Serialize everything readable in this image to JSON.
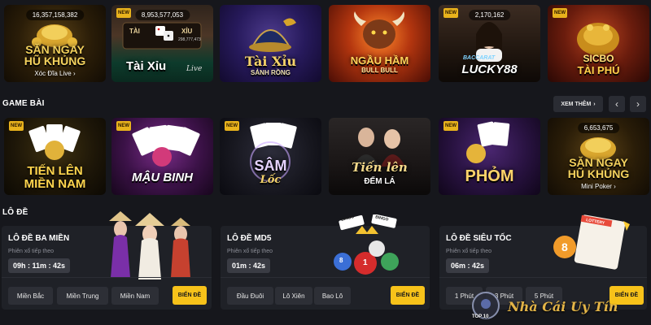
{
  "top_row": [
    {
      "counter": "16,357,158,382",
      "title_line1": "SĂN NGAY",
      "title_line2": "HŨ KHỦNG",
      "subtitle": "Xóc Đĩa Live",
      "subtitle_icon": "chevron-right-icon"
    },
    {
      "counter": "8,953,577,053",
      "title_line1": "Tài Xỉu",
      "title_line2": "Live",
      "inner_left": "TÀI",
      "inner_right": "XỈU",
      "inner_amount": "298,777,473"
    },
    {
      "title_line1": "Tài Xỉu",
      "title_line2": "SẢNH RỒNG"
    },
    {
      "title_line1": "NGẦU HẦM",
      "title_line2": "BULL BULL"
    },
    {
      "counter": "2,170,162",
      "title_line1": "BACCARAT",
      "title_line2": "LUCKY88"
    },
    {
      "title_line1": "SICBO",
      "title_line2": "TÀI PHÚ"
    }
  ],
  "game_bai": {
    "heading": "GAME BÀI",
    "more_label": "XEM THÊM",
    "more_icon": "chevron-right-icon",
    "prev_icon": "chevron-left-icon",
    "next_icon": "chevron-right-icon",
    "tiles": [
      {
        "title_line1": "TIẾN LÊN",
        "title_line2": "MIỀN NAM"
      },
      {
        "title_line1": "MẬU BINH"
      },
      {
        "title_line1": "SÂM",
        "title_line2": "Lốc"
      },
      {
        "title_line1": "Tiến lên",
        "title_line2": "ĐẾM LÁ"
      },
      {
        "title_line1": "PHỎM"
      },
      {
        "counter": "6,653,675",
        "title_line1": "SĂN NGAY",
        "title_line2": "HŨ KHỦNG",
        "subtitle": "Mini Poker",
        "subtitle_icon": "chevron-right-icon"
      }
    ]
  },
  "lo_de": {
    "heading": "LÔ ĐỀ",
    "cards": [
      {
        "name": "LÔ ĐỀ BA MIỀN",
        "next_label": "Phiên xổ tiếp theo",
        "timer": "09h : 11m : 42s",
        "options": [
          "Miền Bắc",
          "Miền Trung",
          "Miền Nam"
        ],
        "button": "BIỂN ĐỀ"
      },
      {
        "name": "LÔ ĐỀ MD5",
        "next_label": "Phiên xổ tiếp theo",
        "timer": "01m : 42s",
        "options": [
          "Đầu Đuôi",
          "Lô Xiên",
          "Bao Lô"
        ],
        "button": "BIỂN ĐỀ",
        "ball_1": "8",
        "ball_2": "1",
        "ball_label_1": "BINGO",
        "ball_label_2": "BINGO"
      },
      {
        "name": "LÔ ĐỀ SIÊU TỐC",
        "next_label": "Phiên xổ tiếp theo",
        "timer": "06m : 42s",
        "options": [
          "1 Phút",
          "3 Phút",
          "5 Phút"
        ],
        "button": "BIỂN ĐỀ",
        "ticket_label": "LOTTERY",
        "ticket_number": "8"
      }
    ]
  },
  "new_badge": "NEW",
  "watermark": {
    "text": "Nhà Cái Uy Tín",
    "logo_text": "TOP 10"
  },
  "colors": {
    "background": "#16171c",
    "card": "#1f2127",
    "accent": "#f7c21a"
  }
}
